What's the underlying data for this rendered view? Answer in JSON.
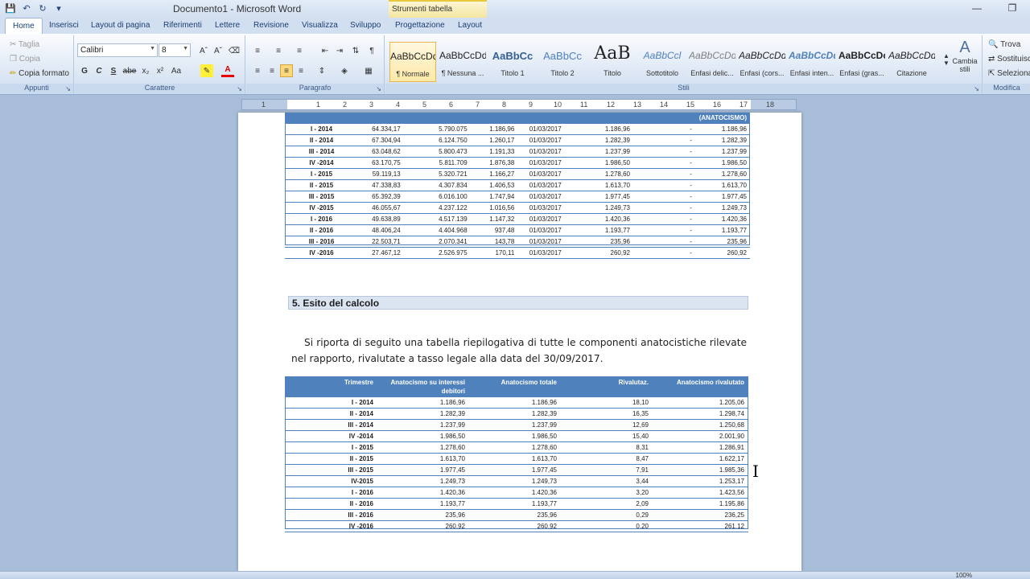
{
  "window": {
    "title": "Documento1 - Microsoft Word",
    "context_tab_group": "Strumenti tabella"
  },
  "tabs": [
    "Home",
    "Inserisci",
    "Layout di pagina",
    "Riferimenti",
    "Lettere",
    "Revisione",
    "Visualizza",
    "Sviluppo",
    "Progettazione",
    "Layout"
  ],
  "ribbon": {
    "clipboard": {
      "label": "Appunti",
      "cut": "Taglia",
      "copy": "Copia",
      "format_painter": "Copia formato"
    },
    "font": {
      "label": "Carattere",
      "font_name": "Calibri",
      "font_size": "8"
    },
    "paragraph": {
      "label": "Paragrafo"
    },
    "styles": {
      "label": "Stili",
      "items": [
        {
          "sample": "AaBbCcDd",
          "name": "¶ Normale"
        },
        {
          "sample": "AaBbCcDd",
          "name": "¶ Nessuna ..."
        },
        {
          "sample": "AaBbCc",
          "name": "Titolo 1"
        },
        {
          "sample": "AaBbCc",
          "name": "Titolo 2"
        },
        {
          "sample": "AaB",
          "name": "Titolo"
        },
        {
          "sample": "AaBbCcl",
          "name": "Sottotitolo"
        },
        {
          "sample": "AaBbCcDd",
          "name": "Enfasi delic..."
        },
        {
          "sample": "AaBbCcDd",
          "name": "Enfasi (cors..."
        },
        {
          "sample": "AaBbCcDd",
          "name": "Enfasi inten..."
        },
        {
          "sample": "AaBbCcDc",
          "name": "Enfasi (gras..."
        },
        {
          "sample": "AaBbCcDd",
          "name": "Citazione"
        }
      ],
      "change_styles": "Cambia stili"
    },
    "editing": {
      "label": "Modifica",
      "find": "Trova",
      "replace": "Sostituisci",
      "select": "Seleziona"
    }
  },
  "ruler": {
    "numbers": [
      "1",
      "1",
      "2",
      "3",
      "4",
      "5",
      "6",
      "7",
      "8",
      "9",
      "10",
      "11",
      "12",
      "13",
      "14",
      "15",
      "16",
      "17",
      "18"
    ]
  },
  "document": {
    "table1": {
      "header_last": "(ANATOCISMO)",
      "rows": [
        [
          "I - 2014",
          "64.334,17",
          "5.790.075",
          "1.186,96",
          "01/03/2017",
          "1.186,96",
          "-",
          "1.186,96"
        ],
        [
          "II - 2014",
          "67.304,94",
          "6.124.750",
          "1.260,17",
          "01/03/2017",
          "1.282,39",
          "-",
          "1.282,39"
        ],
        [
          "III - 2014",
          "63.048,62",
          "5.800.473",
          "1.191,33",
          "01/03/2017",
          "1.237,99",
          "-",
          "1.237,99"
        ],
        [
          "IV -2014",
          "63.170,75",
          "5.811.709",
          "1.876,38",
          "01/03/2017",
          "1.986,50",
          "-",
          "1.986,50"
        ],
        [
          "I - 2015",
          "59.119,13",
          "5.320.721",
          "1.166,27",
          "01/03/2017",
          "1.278,60",
          "-",
          "1.278,60"
        ],
        [
          "II - 2015",
          "47.338,83",
          "4.307.834",
          "1.406,53",
          "01/03/2017",
          "1.613,70",
          "-",
          "1.613,70"
        ],
        [
          "III - 2015",
          "65.392,39",
          "6.016.100",
          "1.747,94",
          "01/03/2017",
          "1.977,45",
          "-",
          "1.977,45"
        ],
        [
          "IV -2015",
          "46.055,67",
          "4.237.122",
          "1.016,56",
          "01/03/2017",
          "1.249,73",
          "-",
          "1.249,73"
        ],
        [
          "I - 2016",
          "49.638,89",
          "4.517.139",
          "1.147,32",
          "01/03/2017",
          "1.420,36",
          "-",
          "1.420,36"
        ],
        [
          "II - 2016",
          "48.406,24",
          "4.404.968",
          "937,48",
          "01/03/2017",
          "1.193,77",
          "-",
          "1.193,77"
        ],
        [
          "III - 2016",
          "22.503,71",
          "2.070.341",
          "143,78",
          "01/03/2017",
          "235,96",
          "-",
          "235,96"
        ],
        [
          "IV -2016",
          "27.467,12",
          "2.526.975",
          "170,11",
          "01/03/2017",
          "260,92",
          "-",
          "260,92"
        ]
      ]
    },
    "heading": "5. Esito del calcolo",
    "paragraph": "Si riporta di seguito una tabella riepilogativa di tutte le componenti anatocistiche rilevate nel rapporto, rivalutate a tasso legale alla data del 30/09/2017.",
    "table2": {
      "headers": [
        "Trimestre",
        "Anatocismo su interessi debitori",
        "Anatocismo totale",
        "Rivalutaz.",
        "Anatocismo rivalutato"
      ],
      "rows": [
        [
          "I - 2014",
          "1.186,96",
          "1.186,96",
          "18,10",
          "1.205,06"
        ],
        [
          "II - 2014",
          "1.282,39",
          "1.282,39",
          "16,35",
          "1.298,74"
        ],
        [
          "III - 2014",
          "1.237,99",
          "1.237,99",
          "12,69",
          "1.250,68"
        ],
        [
          "IV -2014",
          "1.986,50",
          "1.986,50",
          "15,40",
          "2.001,90"
        ],
        [
          "I - 2015",
          "1.278,60",
          "1.278,60",
          "8,31",
          "1.286,91"
        ],
        [
          "II - 2015",
          "1.613,70",
          "1.613,70",
          "8,47",
          "1.622,17"
        ],
        [
          "III - 2015",
          "1.977,45",
          "1.977,45",
          "7,91",
          "1.985,36"
        ],
        [
          "IV-2015",
          "1.249,73",
          "1.249,73",
          "3,44",
          "1.253,17"
        ],
        [
          "I - 2016",
          "1.420,36",
          "1.420,36",
          "3,20",
          "1.423,56"
        ],
        [
          "II - 2016",
          "1.193,77",
          "1.193,77",
          "2,09",
          "1.195,86"
        ],
        [
          "III - 2016",
          "235,96",
          "235,96",
          "0,29",
          "236,25"
        ],
        [
          "IV -2016",
          "260,92",
          "260,92",
          "0,20",
          "261,12"
        ]
      ]
    }
  },
  "status": {
    "zoom": "100%"
  }
}
